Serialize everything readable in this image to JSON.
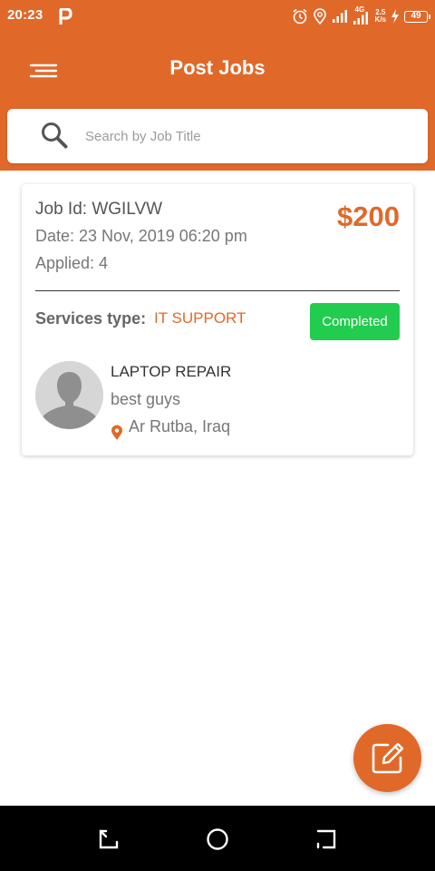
{
  "status_bar": {
    "time": "20:23",
    "network_type": "4G",
    "net_speed_value": "2.5",
    "net_speed_unit": "K/s",
    "battery": "49"
  },
  "header": {
    "title": "Post Jobs"
  },
  "search": {
    "placeholder": "Search by Job Title",
    "value": ""
  },
  "jobs": [
    {
      "job_id": "Job Id: WGILVW",
      "date": "Date: 23 Nov, 2019 06:20 pm",
      "applied": "Applied: 4",
      "price": "$200",
      "services_label": "Services type:",
      "services_value": "IT SUPPORT",
      "status": "Completed",
      "name": "LAPTOP REPAIR",
      "description": "best guys",
      "location": "Ar Rutba, Iraq"
    }
  ],
  "icons": {
    "menu": "menu-icon",
    "search": "search-icon",
    "avatar": "user-avatar-placeholder",
    "location": "location-pin-icon",
    "fab": "edit-icon",
    "nav_back": "back-icon",
    "nav_home": "home-icon",
    "nav_recents": "recents-icon"
  },
  "colors": {
    "primary": "#e0692a",
    "status_completed": "#22cc4f",
    "nav_bar": "#000000"
  }
}
